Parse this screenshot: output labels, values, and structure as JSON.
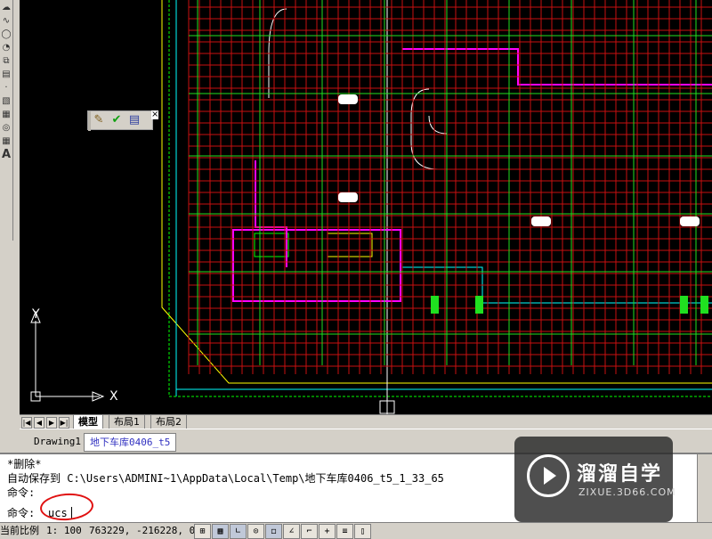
{
  "canvas": {
    "ucs": {
      "y_axis": "Y",
      "x_axis": "X"
    }
  },
  "float_toolbar": {
    "icons": [
      "edit-icon",
      "check-icon",
      "properties-icon"
    ],
    "close": "×"
  },
  "layout_tabs": {
    "nav": [
      "|◀",
      "◀",
      "▶",
      "▶|"
    ],
    "items": [
      {
        "label": "模型",
        "active": true
      },
      {
        "label": "布局1",
        "active": false
      },
      {
        "label": "布局2",
        "active": false
      }
    ]
  },
  "document_tabs": [
    {
      "label": "Drawing1",
      "active": false
    },
    {
      "label": "地下车库0406_t5",
      "active": true
    }
  ],
  "command": {
    "lines": [
      "*删除*",
      "自动保存到 C:\\Users\\ADMINI~1\\AppData\\Local\\Temp\\地下车库0406_t5_1_33_65",
      "命令:"
    ],
    "prompt": "命令:",
    "input": "ucs"
  },
  "status": {
    "scale_label": "当前比例",
    "scale_value": "1: 100",
    "coords": "763229, -216228, 0"
  },
  "watermark": {
    "title": "溜溜自学",
    "url": "ZIXUE.3D66.COM"
  },
  "colors": {
    "canvas_bg": "#000000",
    "annotation_red": "#e01010"
  }
}
